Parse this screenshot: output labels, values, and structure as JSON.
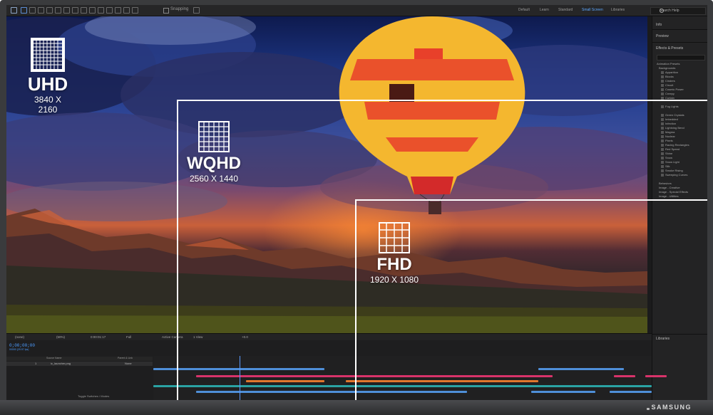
{
  "monitor": {
    "brand": "SAMSUNG"
  },
  "toolbar": {
    "snapping_label": "Snapping",
    "workspaces": [
      "Default",
      "Learn",
      "Standard",
      "Small Screen",
      "Libraries"
    ],
    "active_workspace": "Small Screen",
    "search_placeholder": "Search Help"
  },
  "overlay": {
    "uhd": {
      "name": "UHD",
      "dims": "3840 X 2160"
    },
    "wqhd": {
      "name": "WQHD",
      "dims": "2560 X 1440"
    },
    "fhd": {
      "name": "FHD",
      "dims": "1920 X 1080"
    }
  },
  "right_panel": {
    "tabs": [
      "Info",
      "Preview",
      "Effects & Presets"
    ],
    "tree_root": "Animation Presets",
    "folder": "Backgrounds",
    "effects": [
      "Apparition",
      "Blocks",
      "Cinders",
      "Circuit",
      "Cosmic Power",
      "Creepy",
      "Curtain",
      "Fog Lights",
      "Green Crystals",
      "Imbedded",
      "Infection",
      "Lightning Bend",
      "Magma",
      "Nuclear",
      "Pixels",
      "Racing Rectangles",
      "Red Speed",
      "Shine",
      "Snow",
      "Snow Light",
      "Silk",
      "Smoke Rising",
      "Sweeping Curves"
    ],
    "image_items": [
      "Behaviors",
      "Image - Creative",
      "Image - Special Effects",
      "Image - Utilities"
    ],
    "bottom_label": "Libraries"
  },
  "viewer_controls": {
    "view": "(none)",
    "zoom": "(50%)",
    "timecode": "0:00:01:17",
    "resolution": "Full",
    "camera": "Active Camera",
    "views": "1 View",
    "offset": "+0.0"
  },
  "timeline": {
    "timecode": "0;00;00;00",
    "fps": "00000 (29.97 fps)",
    "columns": [
      "Source Name",
      "Parent & Link"
    ],
    "layer": {
      "number": "1",
      "name": "ic_launcher.png",
      "parent": "None"
    },
    "toggle_label": "Toggle Switches / Modes"
  },
  "colors": {
    "blue_track": "#4f8fd8",
    "pink_track": "#d8336a",
    "orange_track": "#e0762c",
    "teal_track": "#2aa3a3",
    "accent": "#4c9cff"
  }
}
